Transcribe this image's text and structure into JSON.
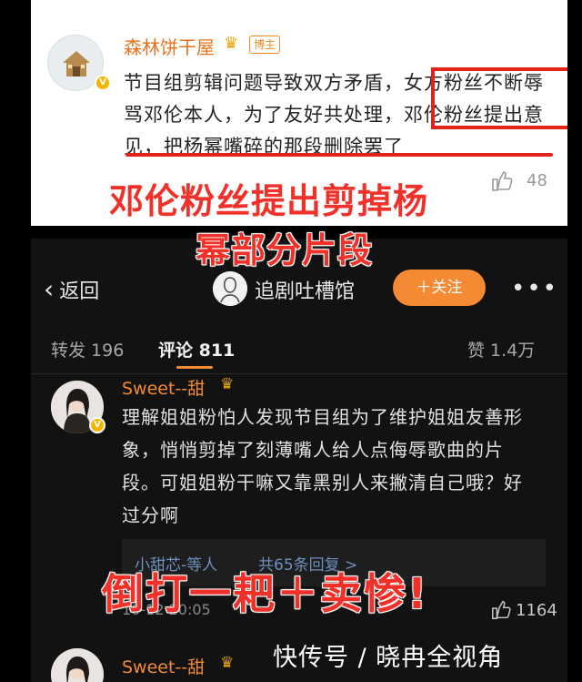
{
  "top_post": {
    "username": "森林饼干屋",
    "badge": "博主",
    "comment_text": "节目组剪辑问题导致双方矛盾，女方粉丝不断辱骂邓伦本人，为了友好共处理，邓伦粉丝提出意见，把杨幂嘴碎的那段删除罢了",
    "like_count": "48"
  },
  "captions": {
    "line1": "邓伦粉丝提出剪掉杨",
    "line2": "幂部分片段",
    "line3": "倒打一耙＋卖惨!"
  },
  "nav": {
    "back_label": "返回",
    "page_name": "追剧吐槽馆",
    "follow_label": "＋关注",
    "more_label": "•••"
  },
  "tabs": {
    "repost": "转发 196",
    "comments": "评论 811",
    "likes": "赞 1.4万"
  },
  "comments": [
    {
      "username": "Sweet--甜",
      "text": "理解姐姐粉怕人发现节目组为了维护姐姐友善形象，悄悄剪掉了刻薄嘴人给人点侮辱歌曲的片段。可姐姐粉干嘛又靠黑别人来撇清自己哦？好过分啊",
      "reply_who": "小甜芯-等人",
      "reply_count": "共65条回复 >",
      "time": "10-12 20:05",
      "likes": "1164"
    },
    {
      "username": "Sweet--甜"
    }
  ],
  "watermark": "快传号 / 晓冉全视角",
  "colors": {
    "accent_orange": "#f58a34",
    "highlight_red": "#e2231a",
    "caption_red": "#f0312a"
  }
}
